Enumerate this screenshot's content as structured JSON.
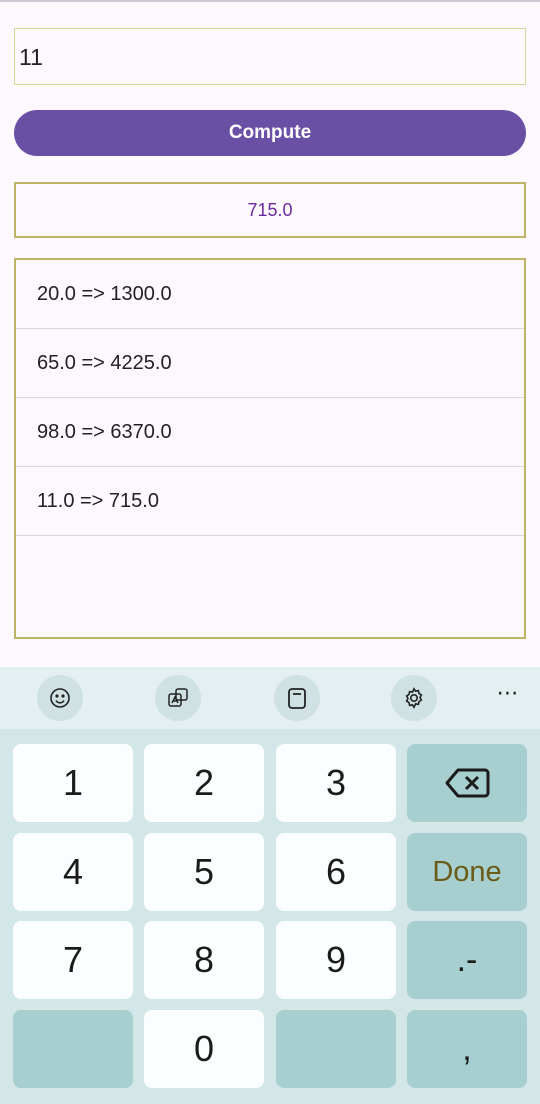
{
  "input": {
    "value": "11"
  },
  "compute_button": {
    "label": "Compute"
  },
  "result": {
    "value": "715.0"
  },
  "history": [
    "20.0 => 1300.0",
    "65.0 => 4225.0",
    "98.0 => 6370.0",
    "11.0 => 715.0"
  ],
  "keyboard": {
    "toolbar_icons": [
      "emoji-icon",
      "translate-icon",
      "clipboard-icon",
      "settings-icon",
      "more-options-icon"
    ],
    "keys": {
      "k1": "1",
      "k2": "2",
      "k3": "3",
      "k4": "4",
      "k5": "5",
      "k6": "6",
      "k7": "7",
      "k8": "8",
      "k9": "9",
      "k0": "0",
      "done": "Done",
      "dot_dash": ".-",
      "comma": ","
    },
    "more_label": "⋯"
  },
  "colors": {
    "accent": "#6a50a4",
    "result_text": "#6a2aa0",
    "border": "#bdb468",
    "keyboard_bg": "#d3e6e8",
    "key_dark": "#a7cfcf"
  }
}
